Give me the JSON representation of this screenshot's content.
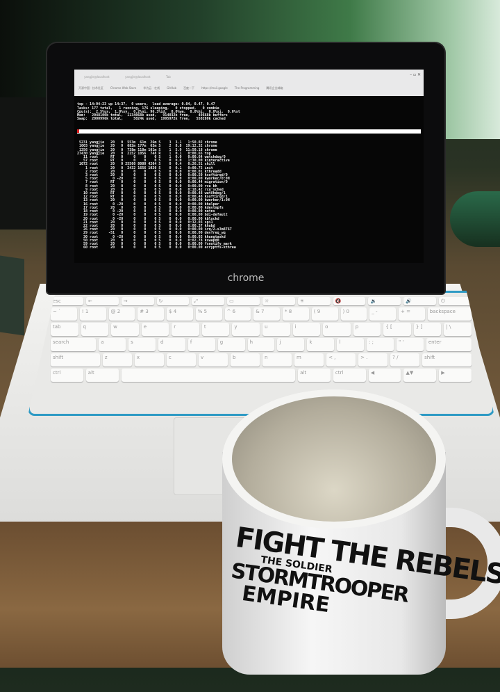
{
  "browser": {
    "tabs": [
      "yangjie@localhost",
      "yangjie@localhost",
      "Tab"
    ],
    "bookmarks": [
      "开源中国 · 技术社区",
      "Chrome Web Store",
      "华为云 · 在线",
      "GitHub",
      "百度一下",
      "https://mail.google",
      "The Programming",
      "腾讯企业邮箱"
    ],
    "window_controls": "– ▫ ✕"
  },
  "terminal": {
    "summary": [
      "top - 14:04:23 up 14:37,  0 users,  load average: 0.04, 0.47, 0.47",
      "Tasks: 177 total,   1 running, 176 sleeping,   0 stopped,   0 zombie",
      "Cpu(s):  2.5%us,  1.0%sy,  0.2%ni, 96.3%id,  0.0%wa,  0.0%hi,  0.0%si,  0.0%st",
      "Mem:   2048100k total,  1134068k used,   914032k free,    49668k buffers",
      "Swap:  2000996k total,     5024k used,  1995972k free,   550280k cached"
    ],
    "processes": [
      " 5231 yangjie   20   0  553m  61m  26m S    3  3.1   1:50.02 chrome",
      " 1003 yangjie   20   0  682m 177m  63m S    2  8.8  19:12.32 chrome",
      " 1256 yangjie   20   0  738m 118m 101m S    1  5.9  11:50.18 chrome",
      "27430 yangjie   20   0  2152 1056  748 R    1  0.1   0:00.65 top",
      "   11 root      RT   0     0    0    0 S    1  0.0   0:00.64 watchdog/0",
      "   57 root      RT   0     0    0    0 S    0  0.0   1:30.00 kinteractive",
      " 1072 root      20   0 25560 8080 4204 S    0  0.4   0:26.51 shill",
      "    1 root      20   0  2432 1656 1020 S    0  0.1   0:00.75 init",
      "    2 root      20   0     0    0    0 S    0  0.0   0:00.01 kthreadd",
      "    3 root      20   0     0    0    0 S    0  0.0   0:00.50 ksoftirqd/0",
      "    5 root       0 -20     0    0    0 S    0  0.0   0:00.00 kworker/0:0H",
      "    7 root      RT   0     0    0    0 S    0  0.0   0:00.44 migration/0",
      "    8 root      20   0     0    0    0 S    0  0.0   0:00.00 rcu_bh",
      "    9 root      20   0     0    0    0 S    0  0.0   0:18.42 rcu_sched",
      "   10 root      RT   0     0    0    0 S    0  0.0   0:00.48 watchdog/1",
      "   12 root      RT   0     0    0    0 S    0  0.0   0:00.48 ksoftirqd/1",
      "   13 root      20   0     0    0    0 S    0  0.0   0:00.00 kworker/1:0H",
      "   16 root       0 -20     0    0    0 S    0  0.0   0:00.00 khelper",
      "   17 root      20   0     0    0    0 S    0  0.0   0:00.00 kdevtmpfs",
      "   18 root       0 -20     0    0    0 S    0  0.0   0:00.00 netns",
      "   19 root       0 -20     0    0    0 S    0  0.0   0:00.00 bdi-default",
      "   20 root       0 -20     0    0    0 S    0  0.0   0:00.00 kblockd",
      "   21 root      20   0     0    0    0 S    0  0.0   0:32.03 spi1",
      "   22 root      20   0     0    0    0 S    0  0.0   0:00.37 khubd",
      "   26 root      20   0     0    0    0 S    0  0.0   0:00.00 irq/2-s3m8767",
      "   29 root     -51   0     0    0    0 S    0  0.0   0:00.00 devfreq_wq",
      "   30 root       0 -20     0    0    0 S    0  0.0   0:00.03 khungtaskd",
      "   50 root      20   0     0    0    0 S    0  0.0   0:02.78 kswapd0",
      "   59 root      20   0     0    0    0 S    0  0.0   0:00.00 fsnotify_mark",
      "   60 root      20   0     0    0    0 S    0  0.0   0:00.00 ecryptfs-kthrea"
    ]
  },
  "laptop": {
    "brand": "chrome"
  },
  "keyboard": {
    "rows": [
      [
        "esc",
        "←",
        "→",
        "↻",
        "⤢",
        "▭",
        "☼",
        "☀",
        "🔇",
        "🔉",
        "🔊",
        "⏻"
      ],
      [
        "~ `",
        "! 1",
        "@ 2",
        "# 3",
        "$ 4",
        "% 5",
        "^ 6",
        "& 7",
        "* 8",
        "( 9",
        ") 0",
        "_ -",
        "+ =",
        "backspace"
      ],
      [
        "tab",
        "q",
        "w",
        "e",
        "r",
        "t",
        "y",
        "u",
        "i",
        "o",
        "p",
        "{ [",
        "} ]",
        "| \\"
      ],
      [
        "search",
        "a",
        "s",
        "d",
        "f",
        "g",
        "h",
        "j",
        "k",
        "l",
        ": ;",
        "\" '",
        "enter"
      ],
      [
        "shift",
        "z",
        "x",
        "c",
        "v",
        "b",
        "n",
        "m",
        "< ,",
        "> .",
        "? /",
        "shift"
      ],
      [
        "ctrl",
        "alt",
        "",
        "alt",
        "ctrl",
        "◀",
        "▲▼",
        "▶"
      ]
    ]
  },
  "mug": {
    "logo_lines": [
      "FIGHT THE REBELS",
      "THE SOLDIER",
      "STORMTROOPER",
      "EMPIRE"
    ]
  }
}
